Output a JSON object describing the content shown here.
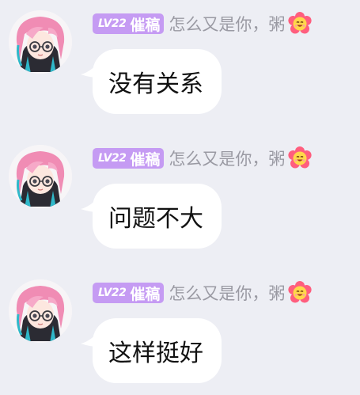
{
  "messages": [
    {
      "badge": {
        "level": "LV22",
        "title": "催稿"
      },
      "nickname": "怎么又是你，粥",
      "text": "没有关系",
      "avatar_icon": "anime-girl-avatar-icon",
      "flower_icon": "flower-smiley-icon"
    },
    {
      "badge": {
        "level": "LV22",
        "title": "催稿"
      },
      "nickname": "怎么又是你，粥",
      "text": "问题不大",
      "avatar_icon": "anime-girl-avatar-icon",
      "flower_icon": "flower-smiley-icon"
    },
    {
      "badge": {
        "level": "LV22",
        "title": "催稿"
      },
      "nickname": "怎么又是你，粥",
      "text": "这样挺好",
      "avatar_icon": "anime-girl-avatar-icon",
      "flower_icon": "flower-smiley-icon"
    }
  ],
  "colors": {
    "background": "#edeef4",
    "badge": "#c59bf3",
    "nickname": "#9a9aa3",
    "bubble": "#ffffff",
    "hair": "#f08cb4"
  }
}
